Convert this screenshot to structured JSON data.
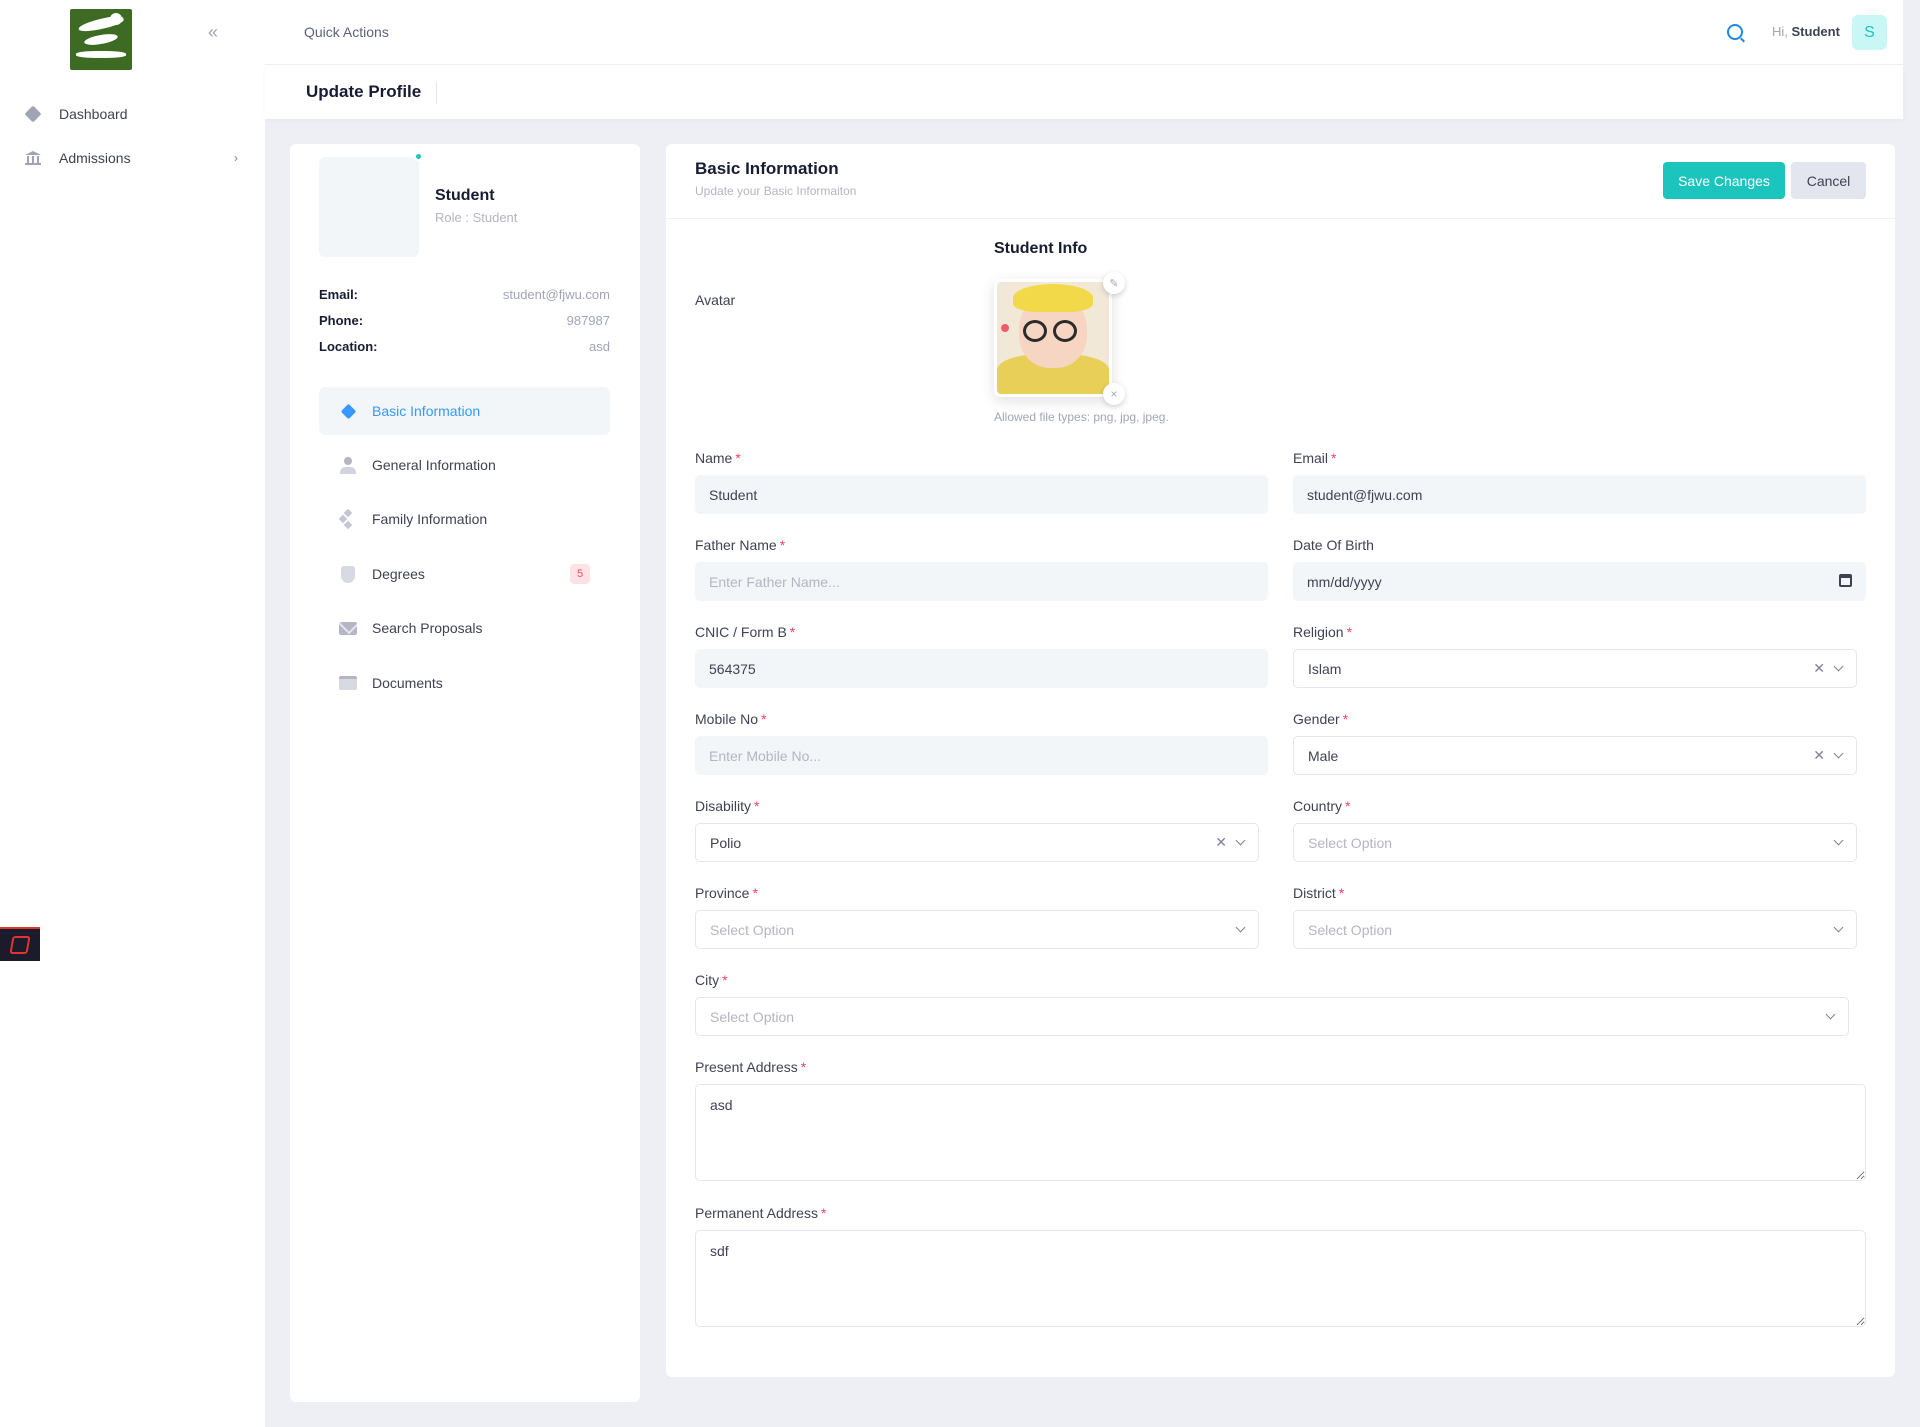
{
  "sidebar": {
    "items": [
      {
        "label": "Dashboard",
        "icon": "diamond-icon"
      },
      {
        "label": "Admissions",
        "icon": "bank-icon"
      }
    ]
  },
  "header": {
    "quick_actions": "Quick Actions",
    "greeting": "Hi,",
    "user_name": "Student",
    "avatar_letter": "S"
  },
  "toolbar": {
    "page_title": "Update Profile"
  },
  "profile": {
    "name": "Student",
    "role": "Role : Student",
    "details": [
      {
        "key": "Email:",
        "value": "student@fjwu.com"
      },
      {
        "key": "Phone:",
        "value": "987987"
      },
      {
        "key": "Location:",
        "value": "asd"
      }
    ],
    "nav": [
      {
        "label": "Basic Information",
        "active": true
      },
      {
        "label": "General Information"
      },
      {
        "label": "Family Information"
      },
      {
        "label": "Degrees",
        "badge": "5"
      },
      {
        "label": "Search Proposals"
      },
      {
        "label": "Documents"
      }
    ]
  },
  "card": {
    "title": "Basic Information",
    "subtitle": "Update your Basic Informaiton",
    "save_label": "Save Changes",
    "cancel_label": "Cancel",
    "section_title": "Student Info",
    "avatar_label": "Avatar",
    "avatar_hint": "Allowed file types: png, jpg, jpeg."
  },
  "form": {
    "name": {
      "label": "Name",
      "value": "Student"
    },
    "email": {
      "label": "Email",
      "value": "student@fjwu.com"
    },
    "father_name": {
      "label": "Father Name",
      "placeholder": "Enter Father Name..."
    },
    "dob": {
      "label": "Date Of Birth",
      "placeholder": "mm/dd/yyyy"
    },
    "cnic": {
      "label": "CNIC / Form B",
      "value": "564375"
    },
    "religion": {
      "label": "Religion",
      "value": "Islam"
    },
    "mobile": {
      "label": "Mobile No",
      "placeholder": "Enter Mobile No..."
    },
    "gender": {
      "label": "Gender",
      "value": "Male"
    },
    "disability": {
      "label": "Disability",
      "value": "Polio"
    },
    "country": {
      "label": "Country",
      "placeholder": "Select Option"
    },
    "province": {
      "label": "Province",
      "placeholder": "Select Option"
    },
    "district": {
      "label": "District",
      "placeholder": "Select Option"
    },
    "city": {
      "label": "City",
      "placeholder": "Select Option"
    },
    "present_address": {
      "label": "Present Address",
      "value": "asd"
    },
    "permanent_address": {
      "label": "Permanent Address",
      "value": "sdf"
    }
  },
  "colors": {
    "primary": "#1bc5bd",
    "active_link": "#3699ff",
    "required": "#f1416c",
    "logo_green": "#3d6b24"
  }
}
